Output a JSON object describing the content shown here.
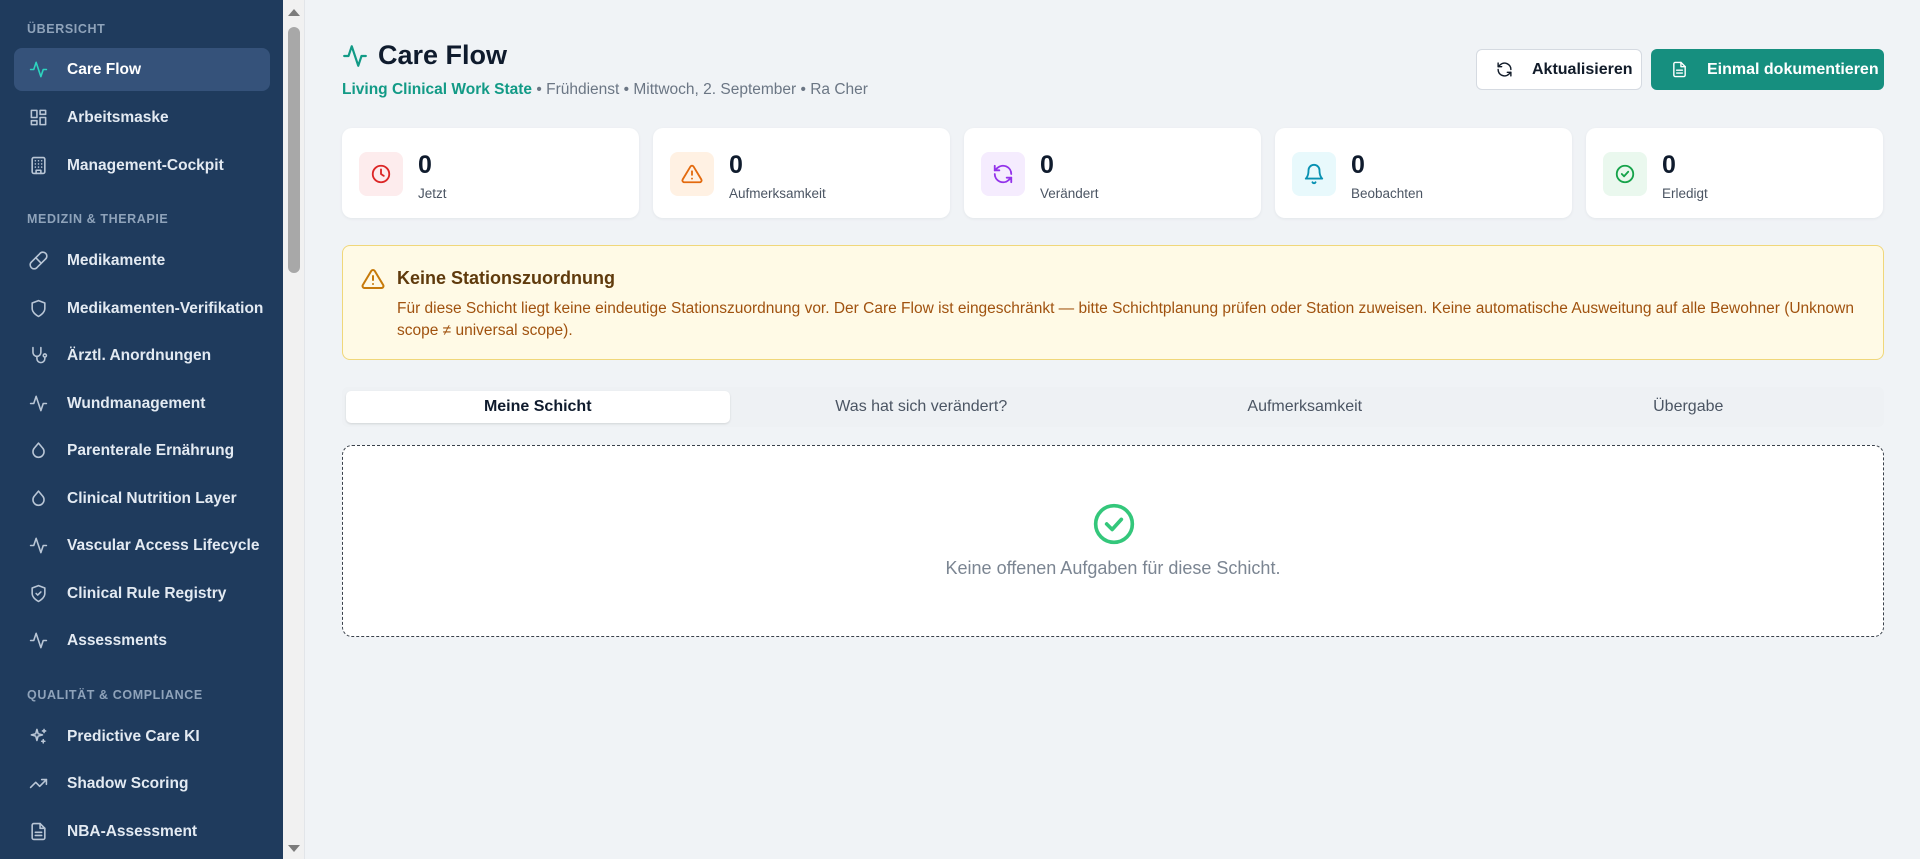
{
  "sidebar": {
    "sections": [
      {
        "title": "ÜBERSICHT",
        "items": [
          {
            "label": "Care Flow",
            "icon": "activity-icon",
            "active": true
          },
          {
            "label": "Arbeitsmaske",
            "icon": "layout-grid-icon"
          },
          {
            "label": "Management-Cockpit",
            "icon": "building-icon"
          }
        ]
      },
      {
        "title": "MEDIZIN & THERAPIE",
        "items": [
          {
            "label": "Medikamente",
            "icon": "pill-icon"
          },
          {
            "label": "Medikamenten-Verifikation",
            "icon": "shield-icon"
          },
          {
            "label": "Ärztl. Anordnungen",
            "icon": "stethoscope-icon"
          },
          {
            "label": "Wundmanagement",
            "icon": "activity-icon"
          },
          {
            "label": "Parenterale Ernährung",
            "icon": "droplet-icon"
          },
          {
            "label": "Clinical Nutrition Layer",
            "icon": "droplet-icon"
          },
          {
            "label": "Vascular Access Lifecycle",
            "icon": "activity-icon"
          },
          {
            "label": "Clinical Rule Registry",
            "icon": "shield-check-icon"
          },
          {
            "label": "Assessments",
            "icon": "activity-icon"
          }
        ]
      },
      {
        "title": "QUALITÄT & COMPLIANCE",
        "items": [
          {
            "label": "Predictive Care KI",
            "icon": "sparkles-icon"
          },
          {
            "label": "Shadow Scoring",
            "icon": "trending-up-icon"
          },
          {
            "label": "NBA-Assessment",
            "icon": "file-text-icon"
          }
        ]
      }
    ]
  },
  "header": {
    "title": "Care Flow",
    "subtitle_accent": "Living Clinical Work State",
    "subtitle_rest": " • Frühdienst • Mittwoch, 2. September • Ra Cher"
  },
  "actions": {
    "refresh_label": "Aktualisieren",
    "document_label": "Einmal dokumentieren"
  },
  "stats": [
    {
      "value": "0",
      "label": "Jetzt",
      "icon": "clock-icon",
      "color": "#dc2626",
      "bg": "#fdeced"
    },
    {
      "value": "0",
      "label": "Aufmerksamkeit",
      "icon": "alert-triangle-icon",
      "color": "#e36a0e",
      "bg": "#fff1e3"
    },
    {
      "value": "0",
      "label": "Verändert",
      "icon": "refresh-icon",
      "color": "#9333ea",
      "bg": "#f5ecfe"
    },
    {
      "value": "0",
      "label": "Beobachten",
      "icon": "bell-icon",
      "color": "#0891b2",
      "bg": "#e8f9fc"
    },
    {
      "value": "0",
      "label": "Erledigt",
      "icon": "check-circle-icon",
      "color": "#16a34a",
      "bg": "#eaf8ee"
    }
  ],
  "alert": {
    "title": "Keine Stationszuordnung",
    "text": "Für diese Schicht liegt keine eindeutige Stationszuordnung vor. Der Care Flow ist eingeschränkt — bitte Schichtplanung prüfen oder Station zuweisen. Keine automatische Ausweitung auf alle Bewohner (Unknown scope ≠ universal scope)."
  },
  "tabs": [
    {
      "label": "Meine Schicht",
      "active": true
    },
    {
      "label": "Was hat sich verändert?"
    },
    {
      "label": "Aufmerksamkeit"
    },
    {
      "label": "Übergabe"
    }
  ],
  "empty_state": {
    "message": "Keine offenen Aufgaben für diese Schicht."
  },
  "colors": {
    "sidebar_bg": "#1f3b5d",
    "accent": "#129a86",
    "primary_button": "#168f7f"
  }
}
